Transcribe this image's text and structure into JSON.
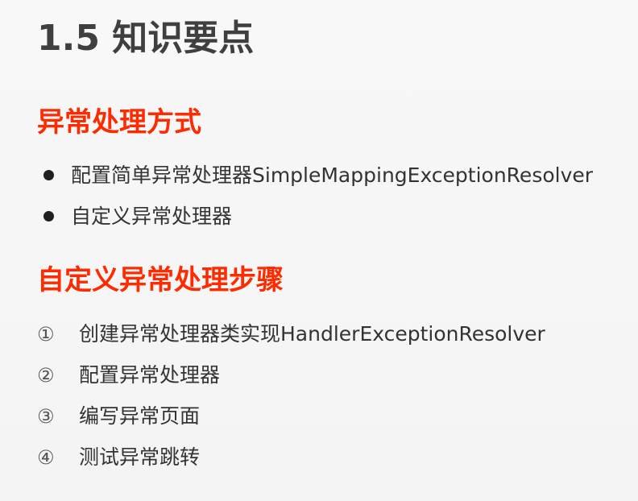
{
  "slide": {
    "title": "1.5 知识要点",
    "sections": [
      {
        "heading": "异常处理方式",
        "bullets": [
          "配置简单异常处理器SimpleMappingExceptionResolver",
          "自定义异常处理器"
        ]
      },
      {
        "heading": "自定义异常处理步骤",
        "steps": [
          {
            "marker": "①",
            "text": "创建异常处理器类实现HandlerExceptionResolver"
          },
          {
            "marker": "②",
            "text": "配置异常处理器"
          },
          {
            "marker": "③",
            "text": "编写异常页面"
          },
          {
            "marker": "④",
            "text": "测试异常跳转"
          }
        ]
      }
    ],
    "colors": {
      "title": "#3f3f3f",
      "heading": "#ff2a00",
      "body_text": "#333333",
      "background": "#f7f7f7"
    }
  }
}
